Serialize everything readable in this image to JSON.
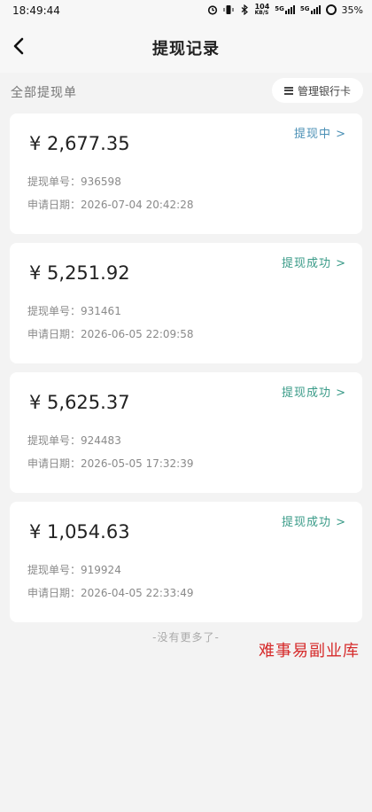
{
  "status_bar": {
    "time": "18:49:44",
    "speed_value": "104",
    "speed_unit": "KB/S",
    "network_1": "5G",
    "network_2": "5G",
    "battery": "35%"
  },
  "header": {
    "title": "提现记录",
    "back_icon": "chevron-left-icon"
  },
  "subbar": {
    "label": "全部提现单",
    "bank_button": "管理银行卡"
  },
  "records": [
    {
      "amount": "¥ 2,677.35",
      "status": "提现中 >",
      "status_type": "processing",
      "order_label": "提现单号：",
      "order_no": "936598",
      "date_label": "申请日期：",
      "date": "2026-07-04 20:42:28"
    },
    {
      "amount": "¥ 5,251.92",
      "status": "提现成功 >",
      "status_type": "success",
      "order_label": "提现单号：",
      "order_no": "931461",
      "date_label": "申请日期：",
      "date": "2026-06-05 22:09:58"
    },
    {
      "amount": "¥ 5,625.37",
      "status": "提现成功 >",
      "status_type": "success",
      "order_label": "提现单号：",
      "order_no": "924483",
      "date_label": "申请日期：",
      "date": "2026-05-05 17:32:39"
    },
    {
      "amount": "¥ 1,054.63",
      "status": "提现成功 >",
      "status_type": "success",
      "order_label": "提现单号：",
      "order_no": "919924",
      "date_label": "申请日期：",
      "date": "2026-04-05 22:33:49"
    }
  ],
  "footer": "-没有更多了-",
  "watermark": "难事易副业库",
  "colors": {
    "processing": "#4a8fb5",
    "success": "#3a9b88",
    "watermark": "#d62b2b"
  }
}
